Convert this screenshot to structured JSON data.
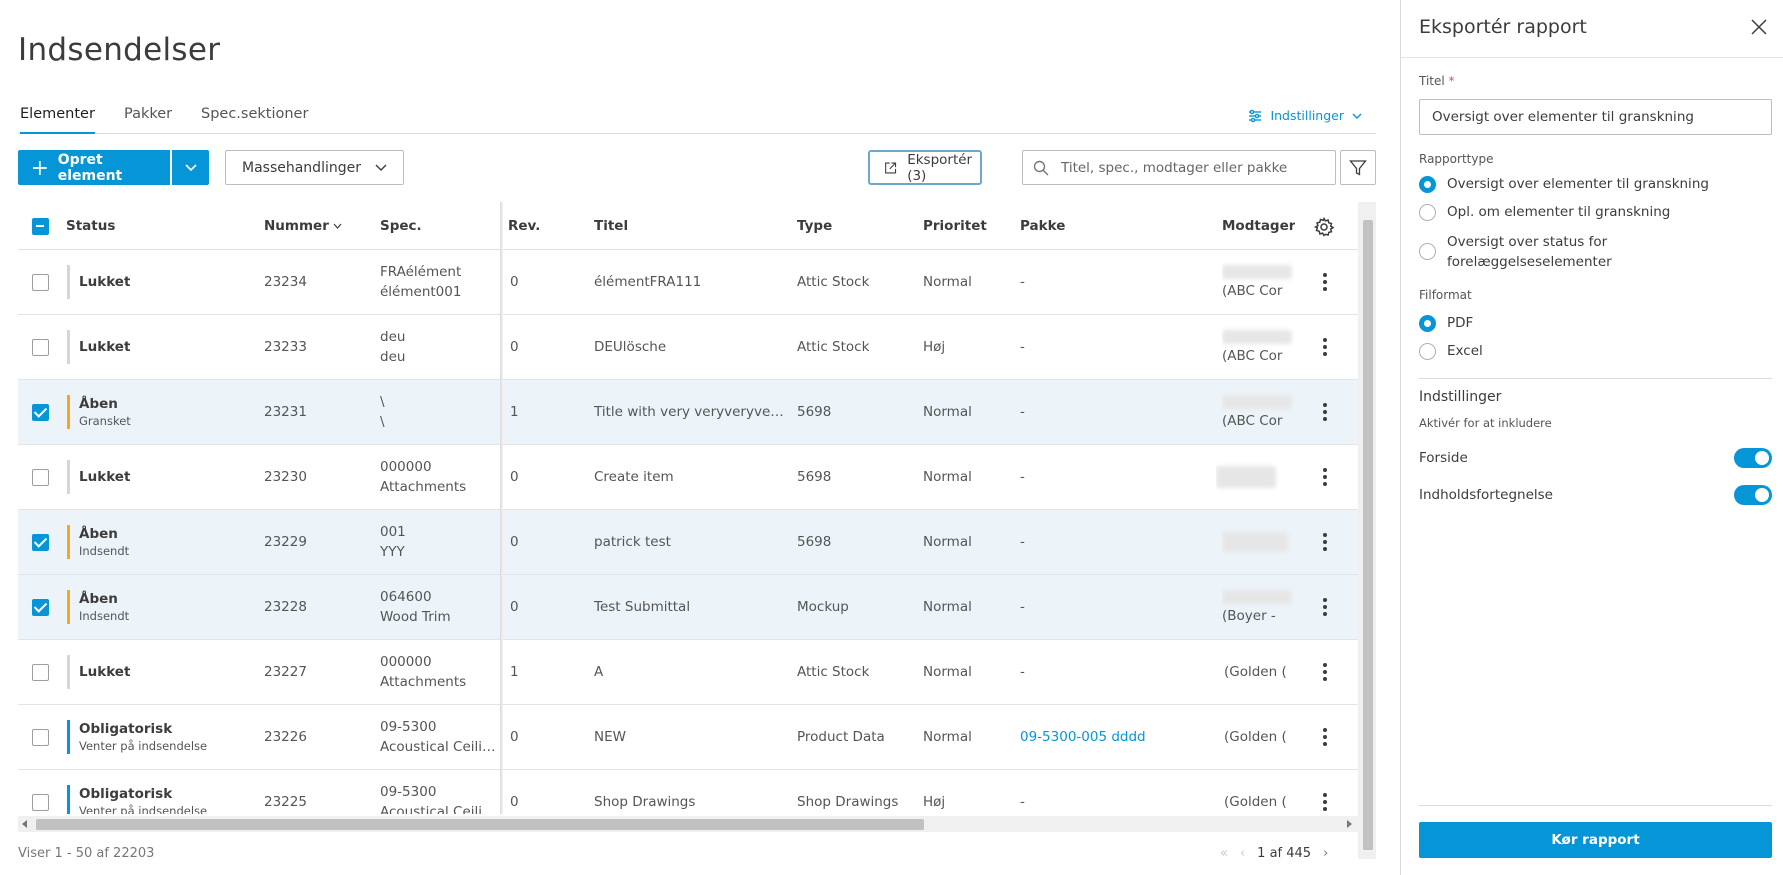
{
  "page_title": "Indsendelser",
  "tabs": [
    {
      "label": "Elementer",
      "active": true
    },
    {
      "label": "Pakker",
      "active": false
    },
    {
      "label": "Spec.sektioner",
      "active": false
    }
  ],
  "settings_link": "Indstillinger",
  "toolbar": {
    "create_label": "Opret element",
    "bulk_label": "Massehandlinger",
    "export_label": "Eksportér (3)",
    "search_placeholder": "Titel, spec., modtager eller pakke"
  },
  "columns": {
    "status": "Status",
    "number": "Nummer",
    "spec": "Spec.",
    "rev": "Rev.",
    "title": "Titel",
    "type": "Type",
    "priority": "Prioritet",
    "package": "Pakke",
    "recipient": "Modtager"
  },
  "rows": [
    {
      "checked": false,
      "status": "Lukket",
      "status_sub": "",
      "status_color": "#d6d6d6",
      "number": "23234",
      "spec_1": "FRAélément",
      "spec_2": "élément001",
      "rev": "0",
      "title": "élémentFRA111",
      "type": "Attic Stock",
      "priority": "Normal",
      "package": "-",
      "package_link": false,
      "recipient": "(ABC Cor",
      "recipient_blur": true
    },
    {
      "checked": false,
      "status": "Lukket",
      "status_sub": "",
      "status_color": "#d6d6d6",
      "number": "23233",
      "spec_1": "deu",
      "spec_2": "deu",
      "rev": "0",
      "title": "DEUlösche",
      "type": "Attic Stock",
      "priority": "Høj",
      "package": "-",
      "package_link": false,
      "recipient": "(ABC Cor",
      "recipient_blur": true
    },
    {
      "checked": true,
      "status": "Åben",
      "status_sub": "Gransket",
      "status_color": "#f5a623",
      "number": "23231",
      "spec_1": "\\",
      "spec_2": "\\",
      "rev": "1",
      "title": "Title with very veryveryve…",
      "type": "5698",
      "priority": "Normal",
      "package": "-",
      "package_link": false,
      "recipient": "(ABC Cor",
      "recipient_blur": true
    },
    {
      "checked": false,
      "status": "Lukket",
      "status_sub": "",
      "status_color": "#d6d6d6",
      "number": "23230",
      "spec_1": "000000",
      "spec_2": "Attachments",
      "rev": "0",
      "title": "Create item",
      "type": "5698",
      "priority": "Normal",
      "package": "-",
      "package_link": false,
      "recipient": "",
      "recipient_blur": true
    },
    {
      "checked": true,
      "status": "Åben",
      "status_sub": "Indsendt",
      "status_color": "#f5a623",
      "number": "23229",
      "spec_1": "001",
      "spec_2": "YYY",
      "rev": "0",
      "title": "patrick test",
      "type": "5698",
      "priority": "Normal",
      "package": "-",
      "package_link": false,
      "recipient": "",
      "recipient_blur": true
    },
    {
      "checked": true,
      "status": "Åben",
      "status_sub": "Indsendt",
      "status_color": "#f5a623",
      "number": "23228",
      "spec_1": "064600",
      "spec_2": "Wood Trim",
      "rev": "0",
      "title": "Test Submittal",
      "type": "Mockup",
      "priority": "Normal",
      "package": "-",
      "package_link": false,
      "recipient": "(Boyer - ",
      "recipient_blur": true
    },
    {
      "checked": false,
      "status": "Lukket",
      "status_sub": "",
      "status_color": "#d6d6d6",
      "number": "23227",
      "spec_1": "000000",
      "spec_2": "Attachments",
      "rev": "1",
      "title": "A",
      "type": "Attic Stock",
      "priority": "Normal",
      "package": "-",
      "package_link": false,
      "recipient": "(Golden (",
      "recipient_blur": false
    },
    {
      "checked": false,
      "status": "Obligatorisk",
      "status_sub": "Venter på indsendelse",
      "status_color": "#0696d7",
      "number": "23226",
      "spec_1": "09-5300",
      "spec_2": "Acoustical Ceili…",
      "rev": "0",
      "title": "NEW",
      "type": "Product Data",
      "priority": "Normal",
      "package": "09-5300-005 dddd",
      "package_link": true,
      "recipient": "(Golden (",
      "recipient_blur": false
    },
    {
      "checked": false,
      "status": "Obligatorisk",
      "status_sub": "Venter på indsendelse",
      "status_color": "#0696d7",
      "number": "23225",
      "spec_1": "09-5300",
      "spec_2": "Acoustical Ceili…",
      "rev": "0",
      "title": "Shop Drawings",
      "type": "Shop Drawings",
      "priority": "Høj",
      "package": "-",
      "package_link": false,
      "recipient": "(Golden (",
      "recipient_blur": false
    }
  ],
  "footer": {
    "count_text": "Viser 1 - 50 af 22203",
    "page_text": "1 af 445"
  },
  "panel": {
    "title": "Eksportér rapport",
    "title_field_label": "Titel",
    "title_field_required": "*",
    "title_field_value": "Oversigt over elementer til granskning",
    "report_type_label": "Rapporttype",
    "report_types": [
      {
        "label_1": "Oversigt over elementer til granskning",
        "label_2": "",
        "selected": true
      },
      {
        "label_1": "Opl. om elementer til granskning",
        "label_2": "",
        "selected": false
      },
      {
        "label_1": "Oversigt over status for",
        "label_2": "forelæggelseselementer",
        "selected": false
      }
    ],
    "file_format_label": "Filformat",
    "file_formats": [
      {
        "label": "PDF",
        "selected": true
      },
      {
        "label": "Excel",
        "selected": false
      }
    ],
    "settings_title": "Indstillinger",
    "settings_sub": "Aktivér for at inkludere",
    "toggles": [
      {
        "label": "Forside",
        "on": true
      },
      {
        "label": "Indholdsfortegnelse",
        "on": true
      }
    ],
    "run_label": "Kør rapport"
  },
  "colors": {
    "accent": "#0696d7",
    "status_open": "#f5a623",
    "status_closed": "#d6d6d6",
    "status_required": "#0696d7",
    "selected_row": "#ecf4f9"
  }
}
